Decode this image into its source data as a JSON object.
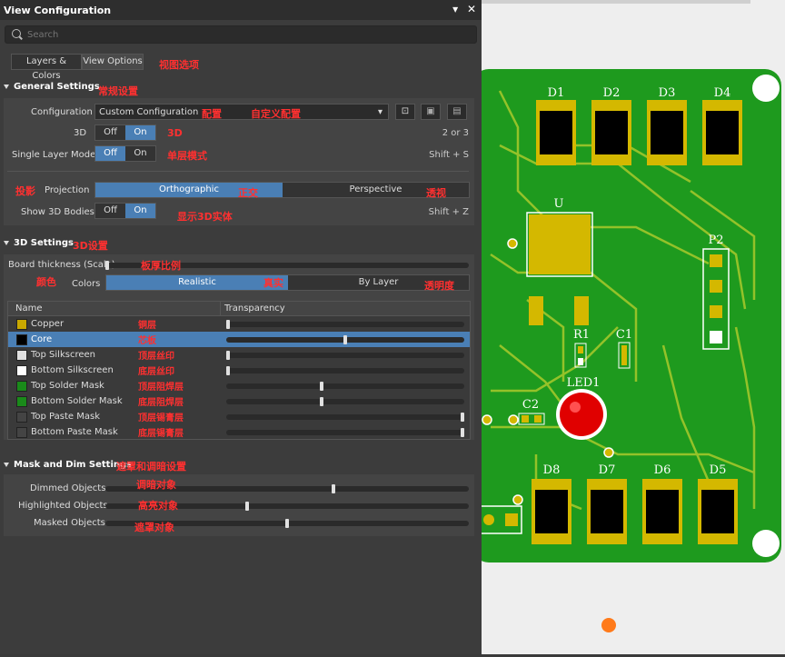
{
  "window": {
    "title": "View Configuration",
    "pin_icon": "pin-icon",
    "close_icon": "close-icon"
  },
  "search": {
    "placeholder": "Search"
  },
  "tabs": [
    {
      "label": "Layers & Colors"
    },
    {
      "label": "View Options"
    }
  ],
  "annotations": {
    "view_options": "视图选项",
    "general": "常规设置",
    "config": "配置",
    "custom_config": "自定义配置",
    "threeD": "3D",
    "single_layer": "单层模式",
    "projection": "投影",
    "ortho": "正交",
    "persp": "透视",
    "show3d": "显示3D实体",
    "settings3d": "3D设置",
    "board_thickness": "板厚比例",
    "colors": "颜色",
    "realistic": "真实",
    "transparency": "透明度",
    "mask_dim": "遮罩和调暗设置",
    "dimmed": "调暗对象",
    "highlighted": "高亮对象",
    "masked": "遮罩对象"
  },
  "general": {
    "title": "General Settings",
    "configuration_label": "Configuration",
    "configuration_value": "Custom Configuration",
    "three_d_label": "3D",
    "three_d_hint": "2 or 3",
    "single_layer_label": "Single Layer Mode",
    "single_layer_hint": "Shift + S",
    "projection_label": "Projection",
    "projection_options": [
      "Orthographic",
      "Perspective"
    ],
    "show3d_label": "Show 3D Bodies",
    "show3d_hint": "Shift + Z",
    "off": "Off",
    "on": "On"
  },
  "settings3d": {
    "title": "3D Settings",
    "board_thickness_label": "Board thickness (Scale)",
    "board_thickness": 0.0,
    "colors_label": "Colors",
    "colors_options": [
      "Realistic",
      "By Layer"
    ]
  },
  "layers": {
    "col_name": "Name",
    "col_transparency": "Transparency",
    "rows": [
      {
        "name": "Copper",
        "color": "#c8a800",
        "transparency": 0.0,
        "ann": "铜层",
        "selected": false
      },
      {
        "name": "Core",
        "color": "#000000",
        "transparency": 0.5,
        "ann": "芯板",
        "selected": true
      },
      {
        "name": "Top Silkscreen",
        "color": "#e0e0e0",
        "transparency": 0.0,
        "ann": "顶层丝印",
        "selected": false
      },
      {
        "name": "Bottom Silkscreen",
        "color": "#ffffff",
        "transparency": 0.0,
        "ann": "底层丝印",
        "selected": false
      },
      {
        "name": "Top Solder Mask",
        "color": "#1a8a1a",
        "transparency": 0.4,
        "ann": "顶层阻焊层",
        "selected": false
      },
      {
        "name": "Bottom Solder Mask",
        "color": "#1a8a1a",
        "transparency": 0.4,
        "ann": "底层阻焊层",
        "selected": false
      },
      {
        "name": "Top Paste Mask",
        "color": "#444444",
        "transparency": 1.0,
        "ann": "顶层锡膏层",
        "selected": false
      },
      {
        "name": "Bottom Paste Mask",
        "color": "#444444",
        "transparency": 1.0,
        "ann": "底层锡膏层",
        "selected": false
      }
    ]
  },
  "mask": {
    "title": "Mask and Dim Settings",
    "dimmed_label": "Dimmed Objects",
    "dimmed": 0.63,
    "highlighted_label": "Highlighted Objects",
    "highlighted": 0.39,
    "masked_label": "Masked Objects",
    "masked": 0.5
  },
  "pcb": {
    "labels": [
      "D1",
      "D2",
      "D3",
      "D4",
      "U",
      "P2",
      "R1",
      "C1",
      "LED1",
      "C2",
      "D8",
      "D7",
      "D6",
      "D5"
    ],
    "board_color": "#1e9a1e",
    "trace_color": "#a9c92c",
    "pad_color": "#d4b800"
  }
}
